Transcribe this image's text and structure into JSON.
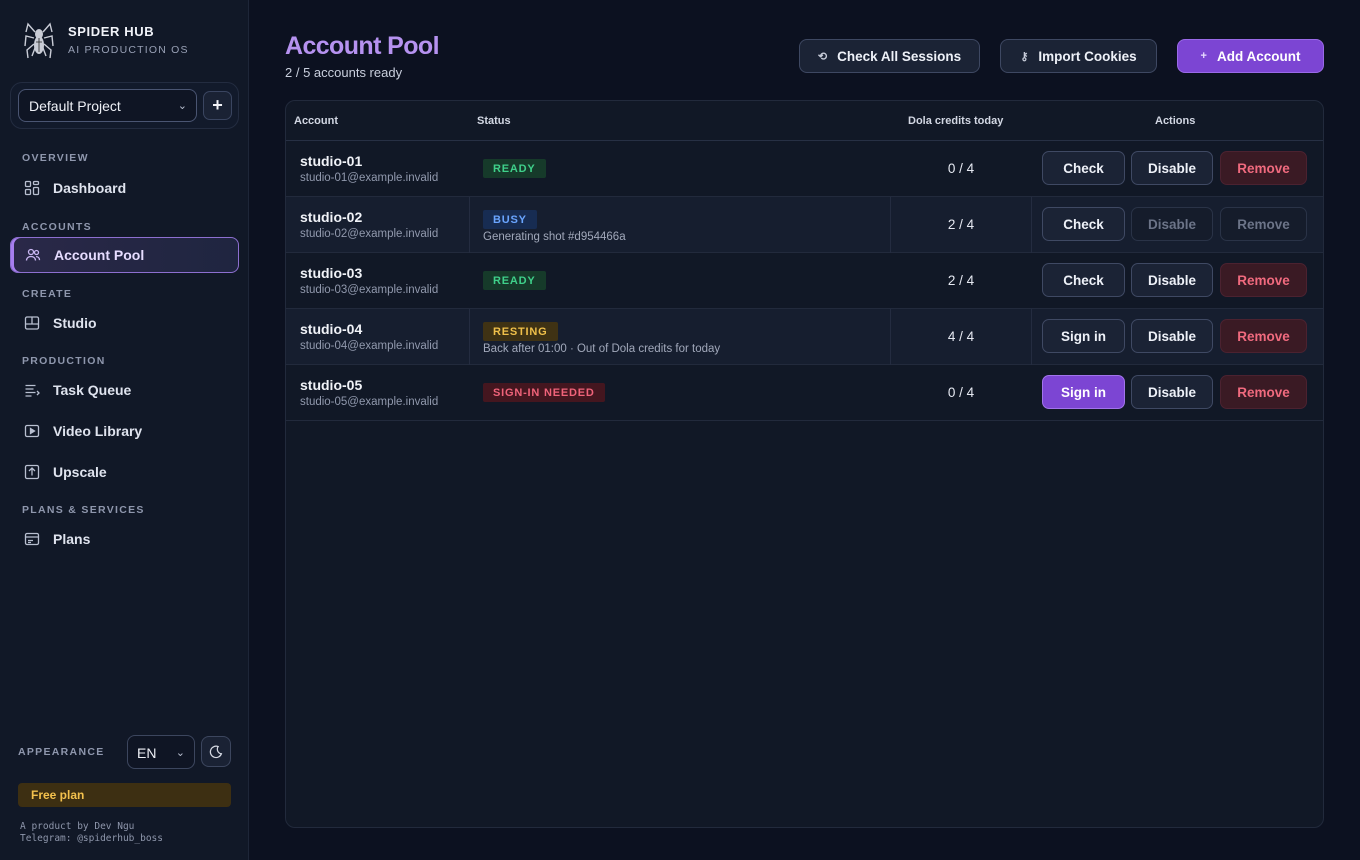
{
  "brand": {
    "name": "SPIDER HUB",
    "subtitle": "AI PRODUCTION OS"
  },
  "project": {
    "selected": "Default Project",
    "add_label": "+"
  },
  "nav": {
    "overview": "OVERVIEW",
    "dashboard": "Dashboard",
    "accounts": "ACCOUNTS",
    "account_pool": "Account Pool",
    "create": "CREATE",
    "studio": "Studio",
    "production": "PRODUCTION",
    "task_queue": "Task Queue",
    "video_library": "Video Library",
    "upscale": "Upscale",
    "plans_services": "PLANS & SERVICES",
    "plans": "Plans"
  },
  "appearance": {
    "label": "APPEARANCE",
    "language": "EN"
  },
  "plan": {
    "label": "Free plan"
  },
  "credit": {
    "line1": "A product by Dev Ngu",
    "line2": "Telegram: @spiderhub_boss"
  },
  "page": {
    "title": "Account Pool",
    "subtitle": "2 / 5 accounts ready"
  },
  "header_buttons": {
    "check_all": "Check All Sessions",
    "import": "Import Cookies",
    "add": "Add Account"
  },
  "table": {
    "columns": {
      "account": "Account",
      "status": "Status",
      "credits": "Dola credits today",
      "actions": "Actions"
    },
    "rows": [
      {
        "name": "studio-01",
        "email": "studio-01@example.invalid",
        "status": "READY",
        "note": "",
        "credits": "0 / 4",
        "primary_action": "Check",
        "disable": "Disable",
        "remove": "Remove"
      },
      {
        "name": "studio-02",
        "email": "studio-02@example.invalid",
        "status": "BUSY",
        "note": "Generating shot #d954466a",
        "credits": "2 / 4",
        "primary_action": "Check",
        "disable": "Disable",
        "remove": "Remove"
      },
      {
        "name": "studio-03",
        "email": "studio-03@example.invalid",
        "status": "READY",
        "note": "",
        "credits": "2 / 4",
        "primary_action": "Check",
        "disable": "Disable",
        "remove": "Remove"
      },
      {
        "name": "studio-04",
        "email": "studio-04@example.invalid",
        "status": "RESTING",
        "note": "Back after 01:00 · Out of Dola credits for today",
        "credits": "4 / 4",
        "primary_action": "Sign in",
        "disable": "Disable",
        "remove": "Remove"
      },
      {
        "name": "studio-05",
        "email": "studio-05@example.invalid",
        "status": "SIGN-IN NEEDED",
        "note": "",
        "credits": "0 / 4",
        "primary_action": "Sign in",
        "disable": "Disable",
        "remove": "Remove"
      }
    ]
  },
  "colors": {
    "accent": "#7c45d3",
    "title": "#b692f0",
    "ready_bg": "#163a2a",
    "ready_fg": "#3fd08a",
    "busy_bg": "#172c52",
    "busy_fg": "#6aa5ff",
    "resting_bg": "#3f3214",
    "resting_fg": "#f0c04a",
    "signin_bg": "#44161f",
    "signin_fg": "#f0637a"
  }
}
